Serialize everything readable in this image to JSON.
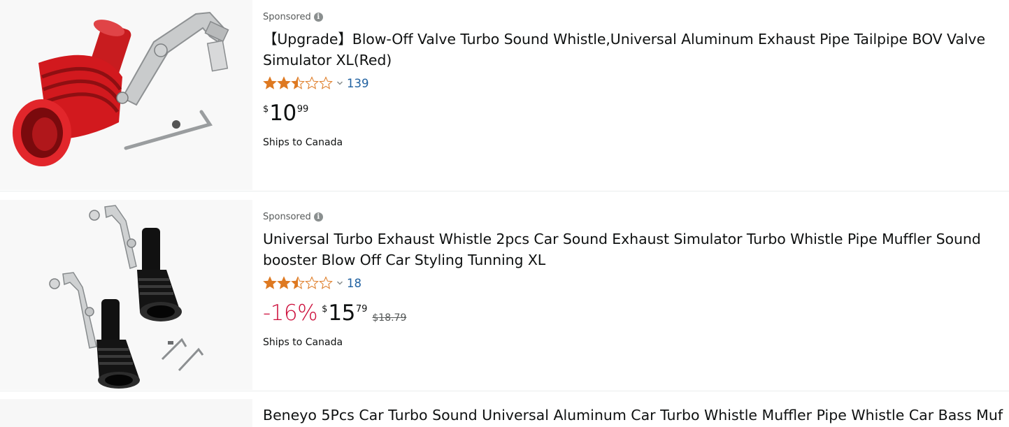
{
  "results": [
    {
      "sponsored_label": "Sponsored",
      "title": "【Upgrade】Blow-Off Valve Turbo Sound Whistle,Universal Aluminum Exhaust Pipe Tailpipe BOV Valve Simulator XL(Red)",
      "rating": 2.5,
      "rating_max": 5,
      "review_count": "139",
      "price_symbol": "$",
      "price_whole": "10",
      "price_fraction": "99",
      "shipping": "Ships to Canada",
      "image_icon": "red-turbo-whistle-product-image"
    },
    {
      "sponsored_label": "Sponsored",
      "title": "Universal Turbo Exhaust Whistle 2pcs Car Sound Exhaust Simulator Turbo Whistle Pipe Muffler Sound booster Blow Off Car Styling Tunning XL",
      "rating": 2.5,
      "rating_max": 5,
      "review_count": "18",
      "discount": "-16%",
      "price_symbol": "$",
      "price_whole": "15",
      "price_fraction": "79",
      "list_price": "$18.79",
      "shipping": "Ships to Canada",
      "image_icon": "black-turbo-whistle-pair-product-image"
    },
    {
      "title_partial": "Beneyo 5Pcs Car Turbo Sound Universal Aluminum Car Turbo Whistle Muffler Pipe Whistle Car Bass Muf"
    }
  ],
  "colors": {
    "star": "#de7921",
    "link": "#2162a1",
    "discount": "#cc0c39",
    "muted": "#565959",
    "text": "#0f1111"
  }
}
